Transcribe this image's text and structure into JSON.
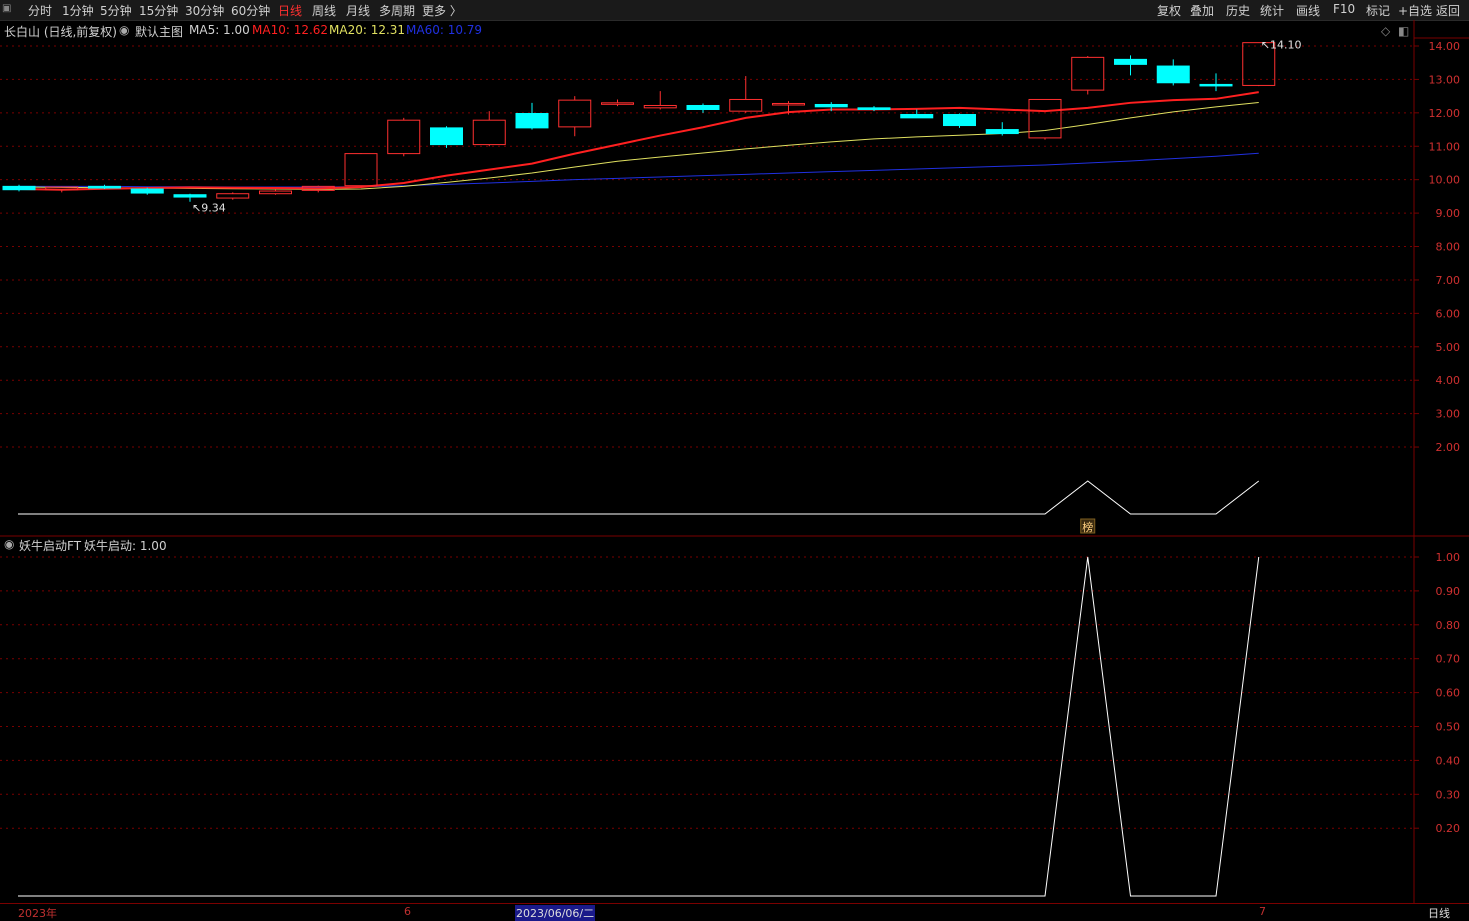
{
  "toolbar": {
    "periods": [
      "分时",
      "1分钟",
      "5分钟",
      "15分钟",
      "30分钟",
      "60分钟",
      "日线",
      "周线",
      "月线",
      "多周期",
      "更多 〉"
    ],
    "active_period": "日线",
    "right_buttons": [
      "复权",
      "叠加",
      "历史",
      "统计",
      "画线",
      "F10",
      "标记",
      "+自选",
      "返回"
    ]
  },
  "main_legend": {
    "stock": "长白山 (日线,前复权)",
    "template": "默认主图",
    "ma5": "MA5: 1.00",
    "ma10": "MA10: 12.62",
    "ma20": "MA20: 12.31",
    "ma60": "MA60: 10.79"
  },
  "colors": {
    "up": "#ff3030",
    "down": "#00ffff",
    "ma10": "#ff2020",
    "ma20": "#e0e060",
    "ma60": "#2030e0",
    "grid": "#7a0000",
    "axis_text": "#d03030"
  },
  "price_axis": [
    "14.00",
    "13.00",
    "12.00",
    "11.00",
    "10.00",
    "9.00",
    "8.00",
    "7.00",
    "6.00",
    "5.00",
    "4.00",
    "3.00",
    "2.00"
  ],
  "annotations": {
    "high": "14.10",
    "low": "9.34",
    "marker": "榜"
  },
  "sub_legend": {
    "indicator": "妖牛启动FT",
    "value": "妖牛启动: 1.00"
  },
  "sub_axis": [
    "1.00",
    "0.90",
    "0.80",
    "0.70",
    "0.60",
    "0.50",
    "0.40",
    "0.30",
    "0.20"
  ],
  "bottom_axis": {
    "year": "2023年",
    "month1": "6",
    "cursor_date": "2023/06/06/二",
    "month2": "7",
    "period": "日线"
  },
  "chart_data": {
    "type": "candlestick",
    "candles": [
      {
        "o": 9.8,
        "h": 9.85,
        "l": 9.65,
        "c": 9.7
      },
      {
        "o": 9.7,
        "h": 9.8,
        "l": 9.62,
        "c": 9.78
      },
      {
        "o": 9.8,
        "h": 9.85,
        "l": 9.72,
        "c": 9.75
      },
      {
        "o": 9.72,
        "h": 9.76,
        "l": 9.55,
        "c": 9.6
      },
      {
        "o": 9.55,
        "h": 9.58,
        "l": 9.34,
        "c": 9.48
      },
      {
        "o": 9.45,
        "h": 9.62,
        "l": 9.4,
        "c": 9.58
      },
      {
        "o": 9.58,
        "h": 9.7,
        "l": 9.55,
        "c": 9.66
      },
      {
        "o": 9.68,
        "h": 9.82,
        "l": 9.62,
        "c": 9.8
      },
      {
        "o": 9.82,
        "h": 10.8,
        "l": 9.8,
        "c": 10.78
      },
      {
        "o": 10.78,
        "h": 11.85,
        "l": 10.7,
        "c": 11.78
      },
      {
        "o": 11.55,
        "h": 11.6,
        "l": 10.95,
        "c": 11.05
      },
      {
        "o": 11.05,
        "h": 12.05,
        "l": 11.0,
        "c": 11.78
      },
      {
        "o": 11.98,
        "h": 12.3,
        "l": 11.5,
        "c": 11.55
      },
      {
        "o": 11.58,
        "h": 12.5,
        "l": 11.3,
        "c": 12.38
      },
      {
        "o": 12.3,
        "h": 12.4,
        "l": 12.2,
        "c": 12.3
      },
      {
        "o": 12.15,
        "h": 12.65,
        "l": 12.1,
        "c": 12.22
      },
      {
        "o": 12.22,
        "h": 12.28,
        "l": 12.0,
        "c": 12.1
      },
      {
        "o": 12.05,
        "h": 13.1,
        "l": 12.0,
        "c": 12.4
      },
      {
        "o": 12.25,
        "h": 12.35,
        "l": 11.95,
        "c": 12.28
      },
      {
        "o": 12.25,
        "h": 12.32,
        "l": 12.05,
        "c": 12.18
      },
      {
        "o": 12.15,
        "h": 12.2,
        "l": 12.05,
        "c": 12.1
      },
      {
        "o": 11.95,
        "h": 12.1,
        "l": 11.88,
        "c": 11.85
      },
      {
        "o": 11.95,
        "h": 11.98,
        "l": 11.55,
        "c": 11.62
      },
      {
        "o": 11.5,
        "h": 11.72,
        "l": 11.32,
        "c": 11.38
      },
      {
        "o": 11.25,
        "h": 12.4,
        "l": 11.2,
        "c": 12.4
      },
      {
        "o": 12.68,
        "h": 13.7,
        "l": 12.55,
        "c": 13.66
      },
      {
        "o": 13.6,
        "h": 13.72,
        "l": 13.12,
        "c": 13.45
      },
      {
        "o": 13.4,
        "h": 13.6,
        "l": 12.82,
        "c": 12.9
      },
      {
        "o": 12.85,
        "h": 13.18,
        "l": 12.65,
        "c": 12.82
      },
      {
        "o": 12.82,
        "h": 14.1,
        "l": 12.8,
        "c": 14.1
      }
    ],
    "ma10": [
      9.72,
      9.7,
      9.73,
      9.75,
      9.77,
      9.76,
      9.75,
      9.74,
      9.78,
      9.9,
      10.12,
      10.3,
      10.48,
      10.78,
      11.05,
      11.32,
      11.57,
      11.85,
      12.02,
      12.1,
      12.1,
      12.12,
      12.15,
      12.1,
      12.05,
      12.15,
      12.3,
      12.38,
      12.42,
      12.62
    ],
    "ma20": [
      9.78,
      9.77,
      9.76,
      9.75,
      9.74,
      9.73,
      9.72,
      9.71,
      9.72,
      9.8,
      9.92,
      10.05,
      10.2,
      10.38,
      10.55,
      10.68,
      10.8,
      10.92,
      11.03,
      11.13,
      11.22,
      11.28,
      11.33,
      11.38,
      11.47,
      11.65,
      11.85,
      12.03,
      12.18,
      12.31
    ],
    "ma60": [
      9.8,
      9.8,
      9.8,
      9.79,
      9.79,
      9.78,
      9.78,
      9.78,
      9.79,
      9.82,
      9.86,
      9.9,
      9.95,
      10.0,
      10.04,
      10.08,
      10.12,
      10.16,
      10.2,
      10.24,
      10.28,
      10.32,
      10.36,
      10.4,
      10.44,
      10.5,
      10.56,
      10.63,
      10.7,
      10.79
    ],
    "signal": [
      0,
      0,
      0,
      0,
      0,
      0,
      0,
      0,
      0,
      0,
      0,
      0,
      0,
      0,
      0,
      0,
      0,
      0,
      0,
      0,
      0,
      0,
      0,
      0,
      0,
      1,
      0,
      0,
      0,
      1
    ],
    "ylim": [
      1.0,
      14.3
    ],
    "sub_ylim": [
      0,
      1.06
    ]
  }
}
